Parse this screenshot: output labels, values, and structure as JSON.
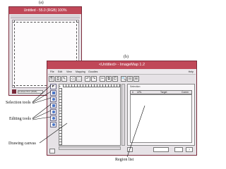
{
  "figure_a": {
    "label": "(a)",
    "window_title": "Untitled - 55.0 (RGB) 100%",
    "status_text": "Untitled-55.0 (RGB)"
  },
  "figure_b": {
    "label": "(b)",
    "window_title": "<Untitled> - ImageMap 1.2",
    "menu": [
      "File",
      "Edit",
      "View",
      "Mapping",
      "Goodies"
    ],
    "help_menu": "Help",
    "toolbar_buttons": [
      "⎘",
      "⎙",
      "✎",
      "◇",
      "⬚",
      "↶",
      "↷",
      "✂",
      "⧉",
      "⧠",
      "🔍",
      "⊟",
      "⊞"
    ],
    "region_list": {
      "section_label": "Selection",
      "columns": [
        "#",
        "URL",
        "Target",
        "Comm"
      ]
    },
    "bottom_buttons": [
      "",
      "",
      "?"
    ]
  },
  "annotations": {
    "selection_tools": "Selection tools",
    "editing_tools": "Editing tools",
    "drawing_canvas": "Drawing canvas",
    "region_list": "Region list"
  },
  "colors": {
    "title_bar": "#c04858",
    "window_border": "#7a2a3a",
    "tool_icon": "#4a76c8"
  }
}
